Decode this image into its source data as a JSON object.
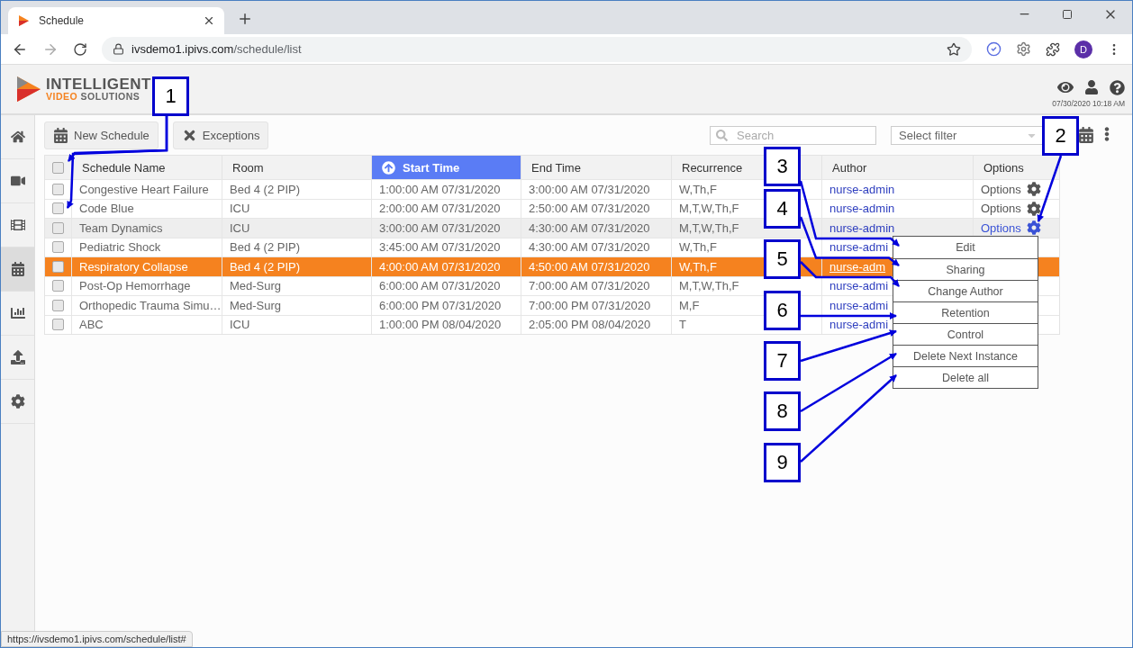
{
  "browser": {
    "tab_title": "Schedule",
    "url_host": "ivsdemo1.ipivs.com",
    "url_path": "/schedule/list",
    "profile_initial": "D",
    "status_url": "https://ivsdemo1.ipivs.com/schedule/list#"
  },
  "header": {
    "logo_top": "INTELLIGENT",
    "logo_bottom_a": "VIDEO",
    "logo_bottom_b": "SOLUTIONS",
    "datetime": "07/30/2020 10:18 AM"
  },
  "sidebar": {
    "items": [
      {
        "kind": "home",
        "selected": false
      },
      {
        "kind": "video",
        "selected": false
      },
      {
        "kind": "film",
        "selected": false
      },
      {
        "kind": "calendar",
        "selected": true
      },
      {
        "kind": "chart",
        "selected": false
      },
      {
        "kind": "upload",
        "selected": false
      },
      {
        "kind": "settings",
        "selected": false
      }
    ]
  },
  "toolbar": {
    "buttons": [
      {
        "kind": "calendar",
        "label": "New Schedule"
      },
      {
        "kind": "close",
        "label": "Exceptions"
      }
    ],
    "search": {
      "placeholder": "Search"
    },
    "filter": {
      "placeholder": "Select filter"
    }
  },
  "table": {
    "columns": [
      {
        "label": "Schedule Name",
        "sorted": false
      },
      {
        "label": "Room",
        "sorted": false
      },
      {
        "label": "Start Time",
        "sorted": true
      },
      {
        "label": "End Time",
        "sorted": false
      },
      {
        "label": "Recurrence",
        "sorted": false
      },
      {
        "label": "Author",
        "sorted": false
      },
      {
        "label": "Options",
        "sorted": false
      }
    ],
    "header_checked": false,
    "rows": [
      {
        "name": "Congestive Heart Failure",
        "room": "Bed 4 (2 PIP)",
        "start": "1:00:00 AM 07/31/2020",
        "end": "3:00:00 AM 07/31/2020",
        "recurrence": "W,Th,F",
        "author": "nurse-admin",
        "options": {
          "label": "Options",
          "active": false
        },
        "checked": false,
        "selected": false,
        "hovered": false
      },
      {
        "name": "Code Blue",
        "room": "ICU",
        "start": "2:00:00 AM 07/31/2020",
        "end": "2:50:00 AM 07/31/2020",
        "recurrence": "M,T,W,Th,F",
        "author": "nurse-admin",
        "options": {
          "label": "Options",
          "active": false
        },
        "checked": false,
        "selected": false,
        "hovered": false
      },
      {
        "name": "Team Dynamics",
        "room": "ICU",
        "start": "3:00:00 AM 07/31/2020",
        "end": "4:30:00 AM 07/31/2020",
        "recurrence": "M,T,W,Th,F",
        "author": "nurse-admin",
        "options": {
          "label": "Options",
          "active": true
        },
        "checked": false,
        "selected": false,
        "hovered": true
      },
      {
        "name": "Pediatric Shock",
        "room": "Bed 4 (2 PIP)",
        "start": "3:45:00 AM 07/31/2020",
        "end": "4:30:00 AM 07/31/2020",
        "recurrence": "W,Th,F",
        "author": "nurse-admi",
        "checked": false,
        "selected": false,
        "hovered": false
      },
      {
        "name": "Respiratory Collapse",
        "room": "Bed 4 (2 PIP)",
        "start": "4:00:00 AM 07/31/2020",
        "end": "4:50:00 AM 07/31/2020",
        "recurrence": "W,Th,F",
        "author": "nurse-adm",
        "checked": false,
        "selected": true,
        "hovered": false
      },
      {
        "name": "Post-Op Hemorrhage",
        "room": "Med-Surg",
        "start": "6:00:00 AM 07/31/2020",
        "end": "7:00:00 AM 07/31/2020",
        "recurrence": "M,T,W,Th,F",
        "author": "nurse-admi",
        "checked": false,
        "selected": false,
        "hovered": false
      },
      {
        "name": "Orthopedic Trauma Simu…",
        "room": "Med-Surg",
        "start": "6:00:00 PM 07/31/2020",
        "end": "7:00:00 PM 07/31/2020",
        "recurrence": "M,F",
        "author": "nurse-admi",
        "checked": false,
        "selected": false,
        "hovered": false
      },
      {
        "name": "ABC",
        "room": "ICU",
        "start": "1:00:00 PM 08/04/2020",
        "end": "2:05:00 PM 08/04/2020",
        "recurrence": "T",
        "author": "nurse-admi",
        "checked": false,
        "selected": false,
        "hovered": false
      }
    ]
  },
  "options_menu": {
    "items": [
      "Edit",
      "Sharing",
      "Change Author",
      "Retention",
      "Control",
      "Delete Next Instance",
      "Delete all"
    ]
  },
  "callouts": [
    {
      "label": "1"
    },
    {
      "label": "2"
    },
    {
      "label": "3"
    },
    {
      "label": "4"
    },
    {
      "label": "5"
    },
    {
      "label": "6"
    },
    {
      "label": "7"
    },
    {
      "label": "8"
    },
    {
      "label": "9"
    }
  ]
}
